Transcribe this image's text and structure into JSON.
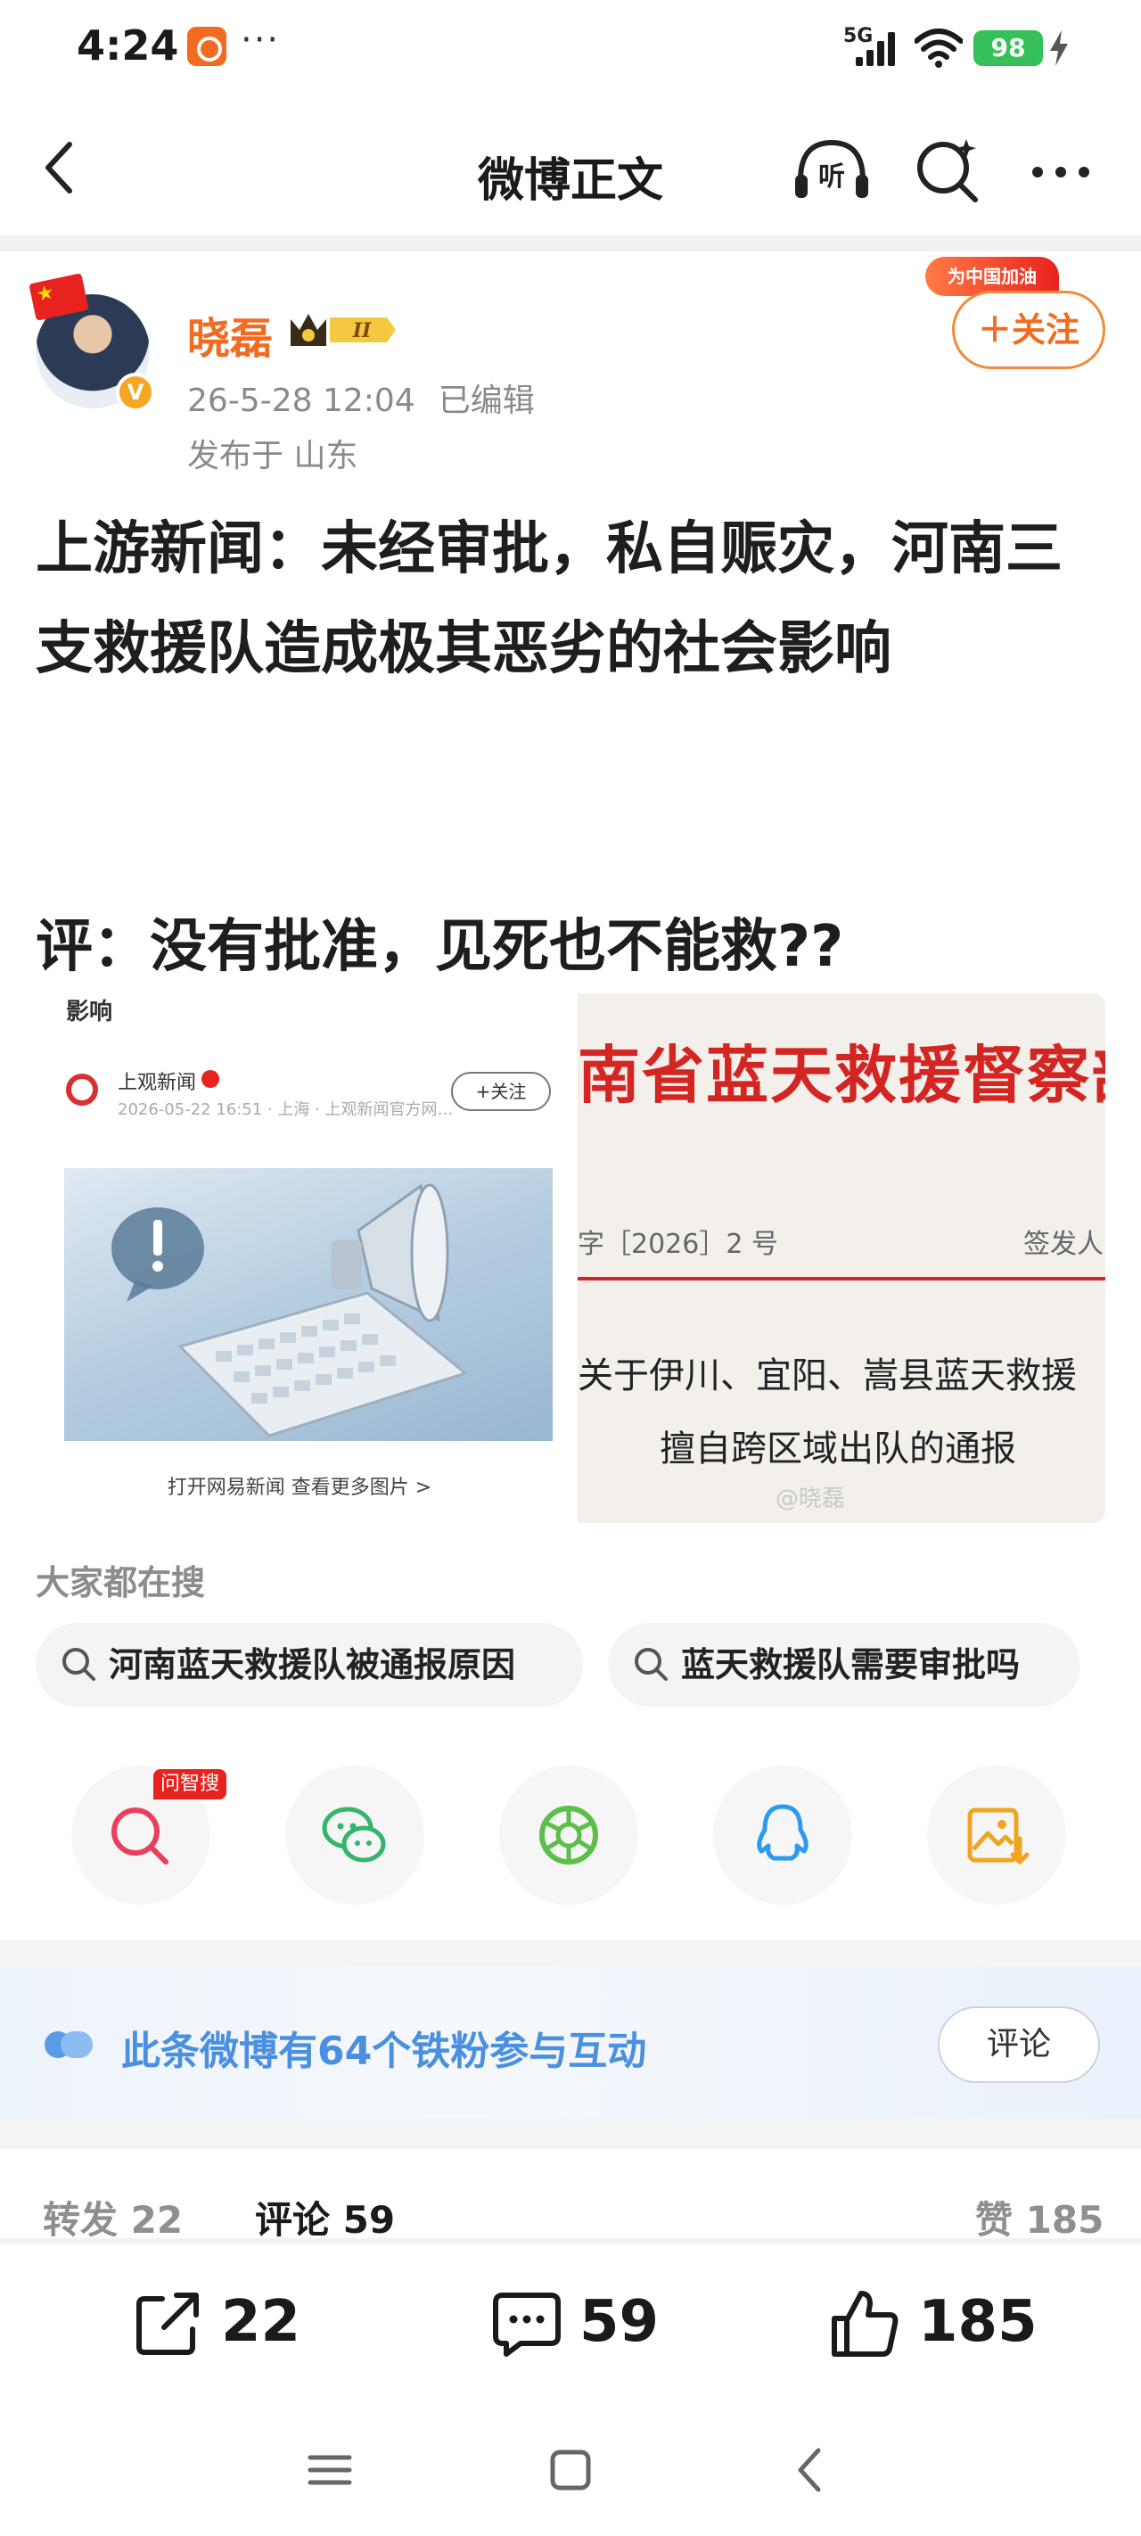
{
  "status_bar": {
    "time": "4:24",
    "dots": "···",
    "network": "5G",
    "battery": "98"
  },
  "nav": {
    "title": "微博正文",
    "listen_icon_text": "听"
  },
  "author": {
    "name": "晓磊",
    "level_badge": "II",
    "verified_mark": "V",
    "date": "26-5-28 12:04",
    "edited": "已编辑",
    "location": "发布于 山东",
    "banner": "为中国加油",
    "follow_label": "＋关注"
  },
  "post": {
    "text": "上游新闻：未经审批，私自赈灾，河南三支救援队造成极其恶劣的社会影响",
    "comment": "评：没有批准，见死也不能救??"
  },
  "image1": {
    "cut_text": "影响",
    "source": "上观新闻",
    "meta": "2026-05-22 16:51 · 上海 · 上观新闻官方网…",
    "follow": "+关注",
    "open_link": "打开网易新闻 查看更多图片 >"
  },
  "image2": {
    "headline": "南省蓝天救援督察部",
    "doc_no": "字［2026］2 号",
    "signer": "签发人",
    "line1": "关于伊川、宜阳、嵩县蓝天救援",
    "line2": "擅自跨区域出队的通报",
    "watermark": "@晓磊"
  },
  "trending": {
    "title": "大家都在搜",
    "chips": [
      "河南蓝天救援队被通报原因",
      "蓝天救援队需要审批吗"
    ]
  },
  "share": {
    "ai_tag": "问智搜",
    "icons": [
      "ai-search-icon",
      "wechat-icon",
      "moments-icon",
      "qq-icon",
      "save-image-icon"
    ]
  },
  "fans": {
    "text": "此条微博有64个铁粉参与互动",
    "button": "评论"
  },
  "tabs": {
    "repost": "转发 22",
    "comment": "评论 59",
    "like": "赞 185"
  },
  "actions": {
    "repost": "22",
    "comment": "59",
    "like": "185"
  },
  "colors": {
    "accent_orange": "#f26b21",
    "fans_blue": "#4a8fe0",
    "battery_green": "#35c05a"
  }
}
